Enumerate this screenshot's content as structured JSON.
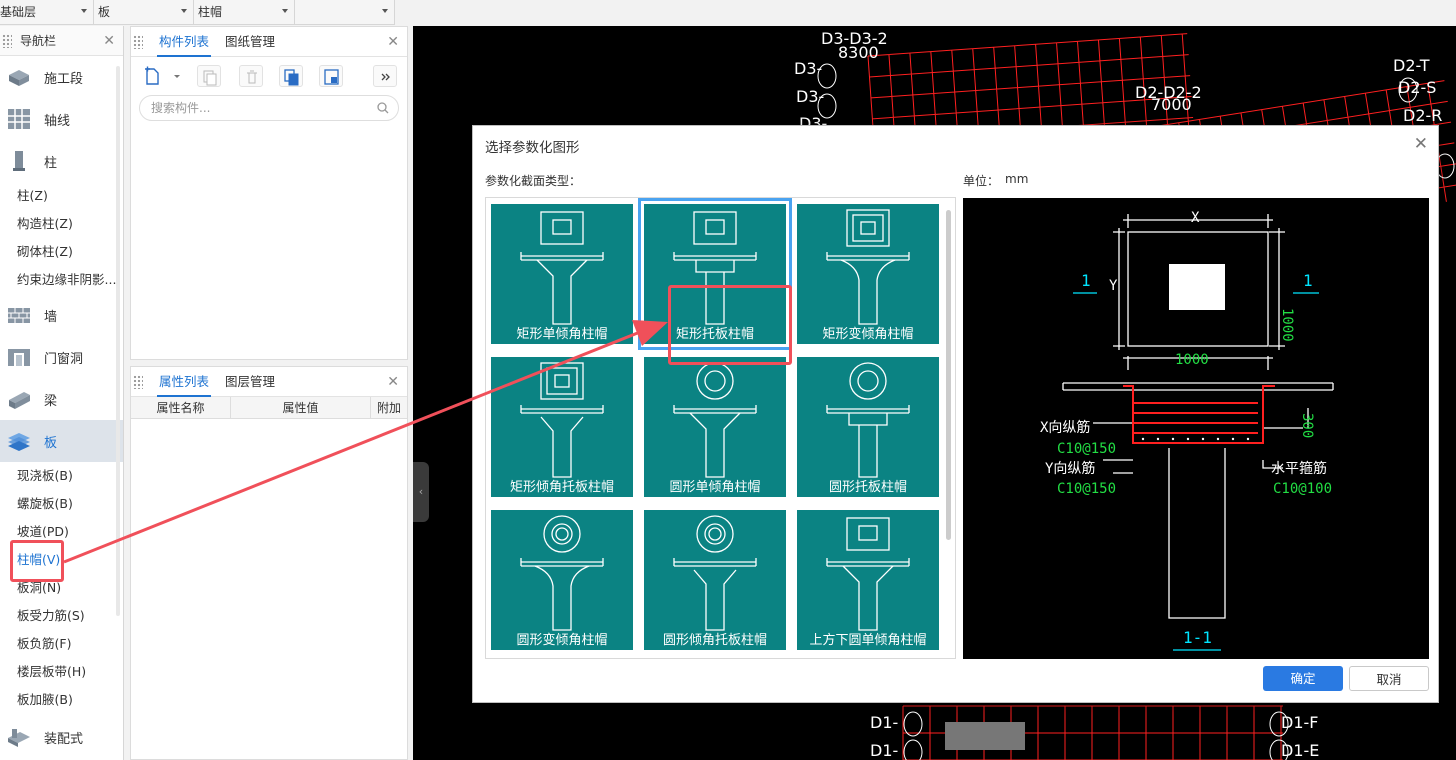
{
  "toolbar": {
    "floor": "基础层",
    "category": "板",
    "component_type": "柱帽",
    "extra": ""
  },
  "nav": {
    "title": "导航栏",
    "sections": [
      {
        "label": "施工段",
        "icon": "construction-stage-icon"
      },
      {
        "label": "轴线",
        "icon": "axis-grid-icon"
      },
      {
        "label": "柱",
        "icon": "column-icon"
      }
    ],
    "column_items": [
      "柱(Z)",
      "构造柱(Z)",
      "砌体柱(Z)",
      "约束边缘非阴影..."
    ],
    "more_sections": [
      {
        "label": "墙",
        "icon": "wall-icon"
      },
      {
        "label": "门窗洞",
        "icon": "door-window-icon"
      },
      {
        "label": "梁",
        "icon": "beam-icon"
      },
      {
        "label": "板",
        "icon": "slab-icon"
      }
    ],
    "slab_items": [
      "现浇板(B)",
      "螺旋板(B)",
      "坡道(PD)",
      "柱帽(V)",
      "板洞(N)",
      "板受力筋(S)",
      "板负筋(F)",
      "楼层板带(H)",
      "板加腋(B)"
    ],
    "last_section": {
      "label": "装配式",
      "icon": "prefab-icon"
    }
  },
  "component_panel": {
    "tabs": [
      "构件列表",
      "图纸管理"
    ],
    "search_placeholder": "搜索构件..."
  },
  "property_panel": {
    "tabs": [
      "属性列表",
      "图层管理"
    ],
    "columns": [
      "属性名称",
      "属性值",
      "附加"
    ]
  },
  "cad_labels": [
    "D3-D3-2",
    "8300",
    "D3-",
    "D3-",
    "D3-",
    "D2-D2-2",
    "7000",
    "D2-T",
    "D2-S",
    "D2-R",
    "D1-",
    "D1-",
    "D1-F",
    "D1-E"
  ],
  "dialog": {
    "title": "选择参数化图形",
    "section_type_label": "参数化截面类型：",
    "unit_label": "单位：",
    "unit_value": "mm",
    "shapes": [
      "矩形单倾角柱帽",
      "矩形托板柱帽",
      "矩形变倾角柱帽",
      "矩形倾角托板柱帽",
      "圆形单倾角柱帽",
      "圆形托板柱帽",
      "圆形变倾角柱帽",
      "圆形倾角托板柱帽",
      "上方下圆单倾角柱帽"
    ],
    "selected_shape": "矩形托板柱帽",
    "ok_label": "确定",
    "cancel_label": "取消",
    "preview": {
      "dim_x": "X",
      "dim_y": "Y",
      "dim_width": "1000",
      "dim_height": "1000",
      "section_mark": "1",
      "x_rebar_label": "X向纵筋",
      "x_rebar_value": "C10@150",
      "y_rebar_label": "Y向纵筋",
      "y_rebar_value": "C10@150",
      "stirrup_label": "水平箍筋",
      "stirrup_value": "C10@100",
      "thickness": "300",
      "section_title": "1-1"
    }
  },
  "colors": {
    "accent": "#1e73d1",
    "teal": "#0b8383",
    "highlight": "#f0505a",
    "cad_red": "#ff2020",
    "cad_green": "#22dd44",
    "cad_cyan": "#00e5ff"
  }
}
